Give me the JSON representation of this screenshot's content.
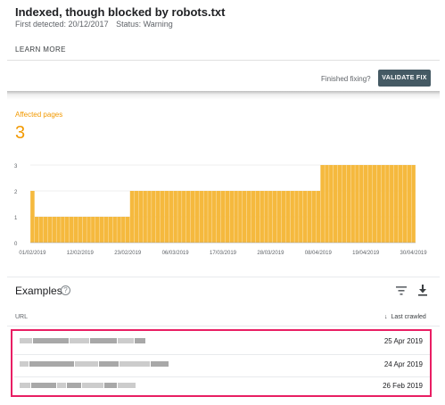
{
  "header": {
    "title": "Indexed, though blocked by robots.txt",
    "first_detected": "First detected: 20/12/2017",
    "status": "Status: Warning",
    "learn_more": "LEARN MORE"
  },
  "fix": {
    "label": "Finished fixing?",
    "button": "VALIDATE FIX"
  },
  "summary": {
    "label": "Affected pages",
    "value": "3"
  },
  "colors": {
    "accent": "#f29900",
    "bar": "#f5b93e",
    "button": "#455a64",
    "highlight": "#e91e63"
  },
  "chart_data": {
    "type": "bar",
    "ylim": [
      0,
      3
    ],
    "yticks": [
      "0",
      "1",
      "2",
      "3"
    ],
    "xticks": [
      "01/02/2019",
      "12/02/2019",
      "23/02/2019",
      "06/03/2019",
      "17/03/2019",
      "28/03/2019",
      "08/04/2019",
      "19/04/2019",
      "30/04/2019"
    ],
    "segments": [
      {
        "from": "01/02/2019",
        "to": "01/02/2019",
        "value": 2
      },
      {
        "from": "02/02/2019",
        "to": "23/02/2019",
        "value": 1
      },
      {
        "from": "24/02/2019",
        "to": "08/04/2019",
        "value": 2
      },
      {
        "from": "09/04/2019",
        "to": "30/04/2019",
        "value": 3
      }
    ]
  },
  "examples": {
    "title": "Examples",
    "col_url": "URL",
    "col_crawled": "Last crawled",
    "rows": [
      {
        "date": "25 Apr 2019"
      },
      {
        "date": "24 Apr 2019"
      },
      {
        "date": "26 Feb 2019"
      }
    ]
  },
  "icons": {
    "help": "help-circle-icon",
    "filter": "filter-icon",
    "download": "download-icon",
    "sort": "arrow-down-icon"
  }
}
